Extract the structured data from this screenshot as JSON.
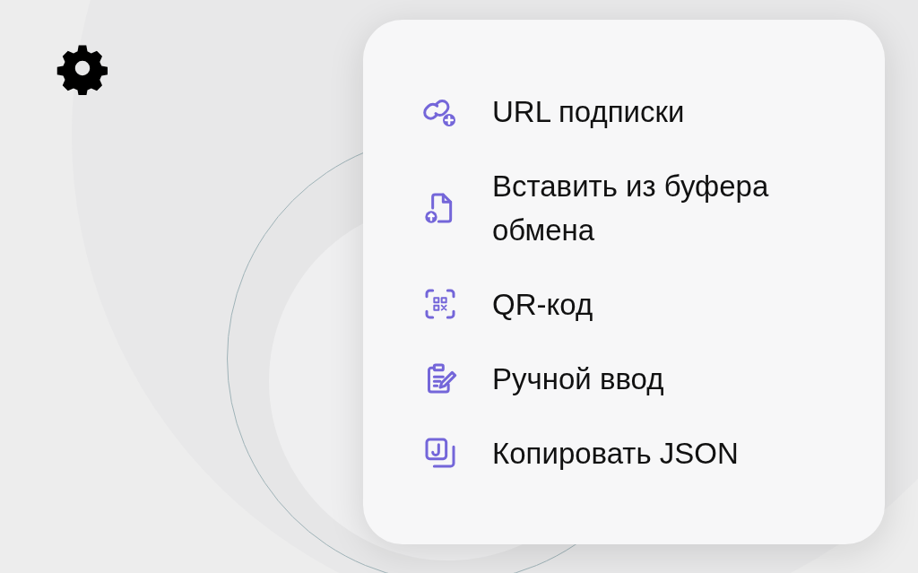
{
  "menu": {
    "items": [
      {
        "kind": "link",
        "label": "URL подписки"
      },
      {
        "kind": "clipboard",
        "label": "Вставить из буфера обмена"
      },
      {
        "kind": "qr",
        "label": "QR-код"
      },
      {
        "kind": "manual",
        "label": "Ручной ввод"
      },
      {
        "kind": "json",
        "label": "Копировать JSON"
      }
    ]
  }
}
